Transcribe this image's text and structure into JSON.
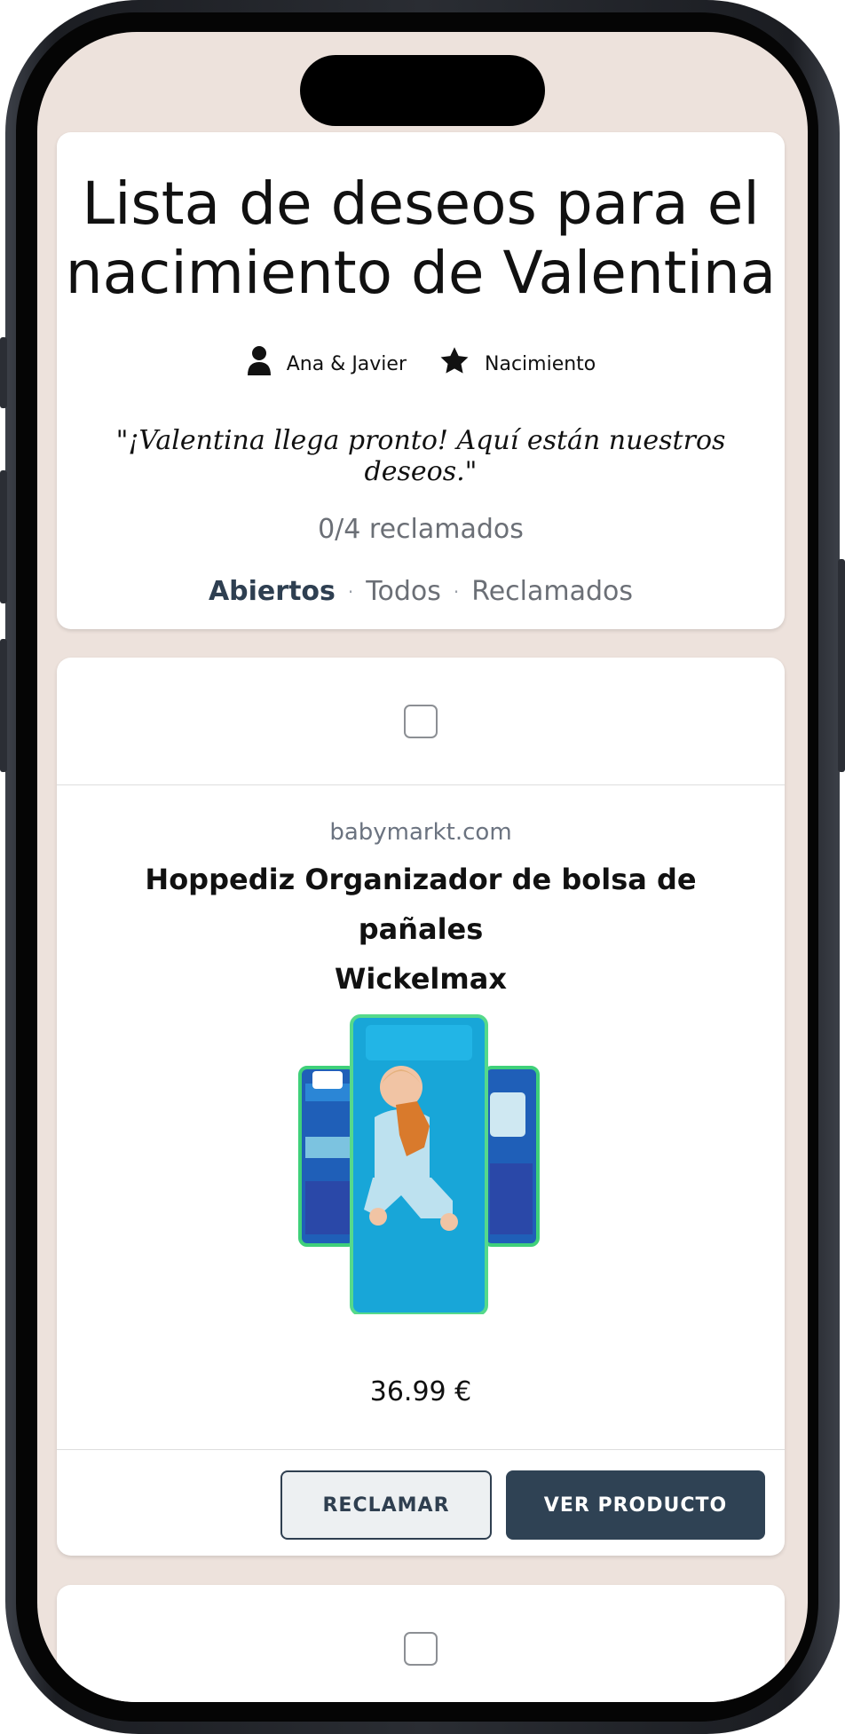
{
  "header": {
    "title_line1": "Lista de deseos para el",
    "title_line2": "nacimiento de Valentina",
    "owners": "Ana & Javier",
    "occasion": "Nacimiento",
    "owners_icon": "person-icon",
    "occasion_icon": "star-icon",
    "message": "\"¡Valentina llega pronto! Aquí están nuestros deseos.\"",
    "claimed_count": "0/4 reclamados",
    "filters": [
      {
        "label": "Abiertos",
        "active": true
      },
      {
        "label": "Todos",
        "active": false
      },
      {
        "label": "Reclamados",
        "active": false
      }
    ],
    "filter_separator": "·"
  },
  "items": [
    {
      "checked": false,
      "domain": "babymarkt.com",
      "name_line1": "Hoppediz Organizador de bolsa de pañales",
      "name_line2": "Wickelmax",
      "price": "36.99 €",
      "claim_label": "RECLAMAR",
      "view_label": "VER PRODUCTO"
    },
    {
      "checked": false
    }
  ],
  "colors": {
    "background": "#ede2dc",
    "accent": "#2f4254",
    "muted_text": "#6b6f76"
  }
}
